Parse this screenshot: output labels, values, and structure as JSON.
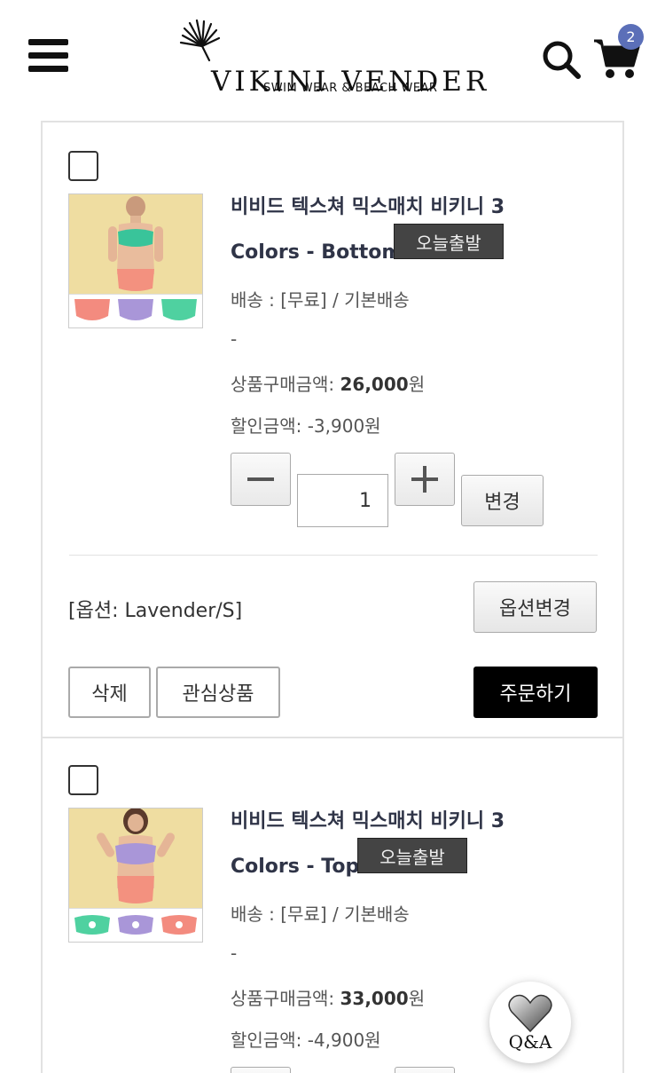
{
  "header": {
    "brand_title": "VIKINI VENDER",
    "brand_subtitle": "SWIM WEAR & BEACH WEAR",
    "cart_count": "2"
  },
  "items": [
    {
      "name_line1": "비비드 텍스쳐 믹스매치 비키니 3",
      "name_line2": "Colors - Bottom",
      "badge": "오늘출발",
      "shipping": "배송 : [무료] / 기본배송",
      "dash": "-",
      "price_label": "상품구매금액: ",
      "price_value": "26,000",
      "price_unit": "원",
      "discount": "할인금액: -3,900원",
      "qty": "1",
      "change_label": "변경",
      "option_text": "[옵션: Lavender/S]",
      "option_change_label": "옵션변경",
      "delete_label": "삭제",
      "wishlist_label": "관심상품",
      "order_label": "주문하기",
      "swatch_colors": [
        "#f38b7f",
        "#a996d8",
        "#4fd1a0"
      ]
    },
    {
      "name_line1": "비비드 텍스쳐 믹스매치 비키니 3",
      "name_line2": "Colors - Top",
      "badge": "오늘출발",
      "shipping": "배송 : [무료] / 기본배송",
      "dash": "-",
      "price_label": "상품구매금액: ",
      "price_value": "33,000",
      "price_unit": "원",
      "discount": "할인금액: -4,900원",
      "swatch_colors": [
        "#4fd1a0",
        "#a996d8",
        "#f38b7f"
      ]
    }
  ],
  "qa": {
    "label": "Q&A"
  }
}
